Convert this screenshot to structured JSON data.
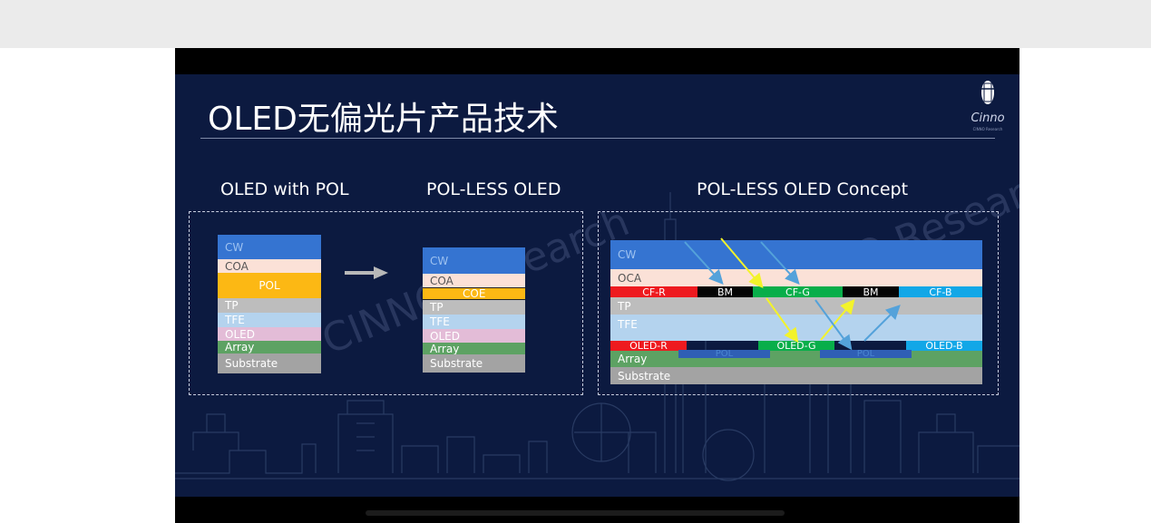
{
  "colors": {
    "slide_bg": "#0c1a40",
    "cw": "#3574d1",
    "coa": "#fbe1d7",
    "pol": "#fcb814",
    "tp": "#bdbdbd",
    "tfe": "#b4d3ee",
    "oled": "#e3bcd7",
    "array": "#5da263",
    "substrate": "#a3a3a3",
    "red": "#ee1a1f",
    "green": "#08ae4a",
    "blue": "#12a7e7",
    "black": "#050505",
    "pol_blue": "#2f5fb5",
    "yellow_arrow": "#f3f32a",
    "blue_arrow": "#54a2da"
  },
  "slide": {
    "title": "OLED无偏光片产品技术",
    "logo_text": "Cinno",
    "logo_sub": "CINNO Research"
  },
  "headings": {
    "left": "OLED with POL",
    "middle": "POL-LESS OLED",
    "right": "POL-LESS OLED Concept"
  },
  "watermarks": {
    "left": "CINNO Research",
    "right": "CINNO Research"
  },
  "stack_with_pol": {
    "cw": "CW",
    "coa": "COA",
    "pol": "POL",
    "tp": "TP",
    "tfe": "TFE",
    "oled": "OLED",
    "array": "Array",
    "substrate": "Substrate"
  },
  "stack_pol_less": {
    "cw": "CW",
    "coa": "COA",
    "coe": "COE",
    "tp": "TP",
    "tfe": "TFE",
    "oled": "OLED",
    "array": "Array",
    "substrate": "Substrate"
  },
  "concept": {
    "cw": "CW",
    "oca": "OCA",
    "cf_r": "CF-R",
    "bm_1": "BM",
    "cf_g": "CF-G",
    "bm_2": "BM",
    "cf_b": "CF-B",
    "tp": "TP",
    "tfe": "TFE",
    "oled_r": "OLED-R",
    "oled_g": "OLED-G",
    "oled_b": "OLED-B",
    "pol_1": "POL",
    "pol_2": "POL",
    "array": "Array",
    "substrate": "Substrate"
  }
}
